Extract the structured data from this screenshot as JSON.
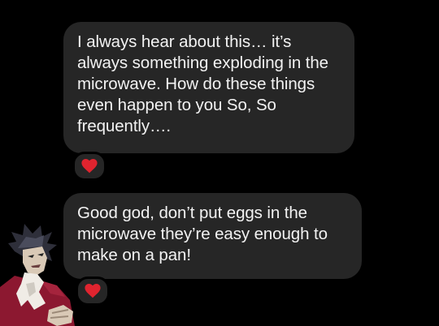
{
  "messages": [
    {
      "text": "I always hear about this… it’s always something exploding in the microwave. How do these things even happen to you So, So frequently….",
      "reaction": "heart-icon"
    },
    {
      "text": "Good god, don’t put eggs in the microwave they’re easy enough to make on a pan!",
      "reaction": "heart-icon"
    }
  ],
  "colors": {
    "background": "#000000",
    "bubble": "#262626",
    "text": "#f2f2f2",
    "heart": "#e0242f"
  }
}
